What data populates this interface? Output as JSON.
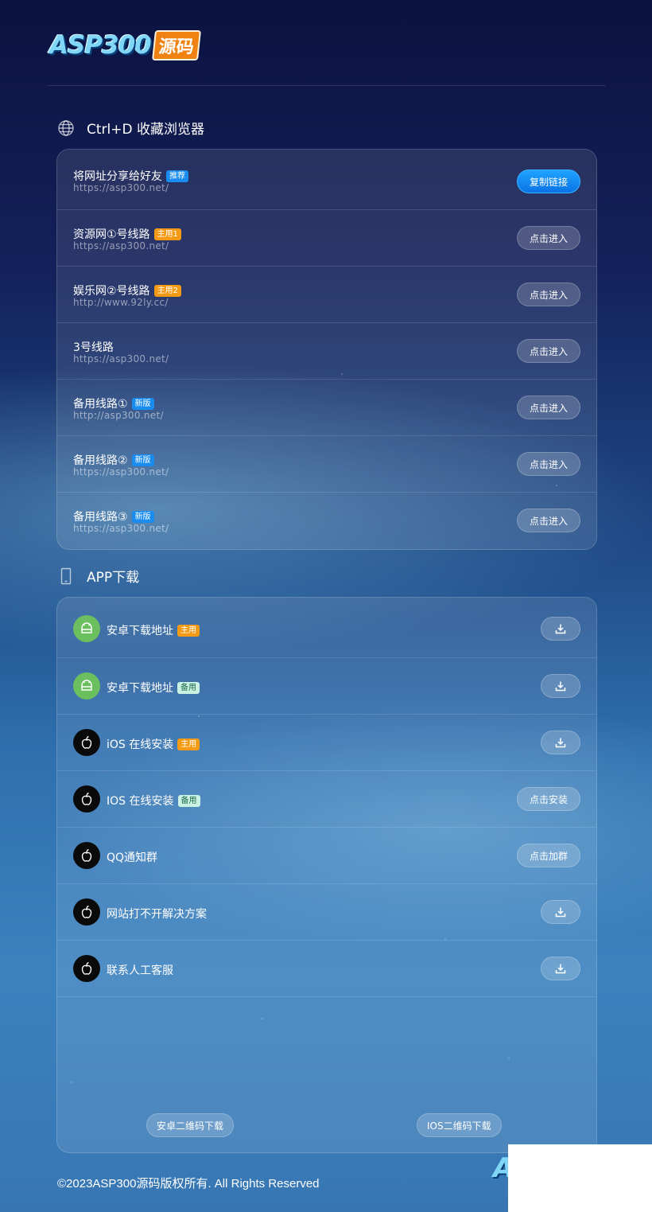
{
  "header": {
    "logo_text": "ASP300",
    "logo_badge": "源码"
  },
  "bookmark_section": {
    "title": "Ctrl+D 收藏浏览器",
    "icon": "globe-icon"
  },
  "links": [
    {
      "name": "将网址分享给好友",
      "tag": "推荐",
      "tag_color": "#1a8cf0",
      "url": "https://asp300.net/",
      "button": "复制链接",
      "primary": true
    },
    {
      "name": "资源网①号线路",
      "tag": "主用1",
      "tag_color": "#f49a14",
      "url": "https://asp300.net/",
      "button": "点击进入"
    },
    {
      "name": "娱乐网②号线路",
      "tag": "主用2",
      "tag_color": "#f49a14",
      "url": "http://www.92ly.cc/",
      "button": "点击进入"
    },
    {
      "name": "3号线路",
      "tag": "",
      "url": "https://asp300.net/",
      "button": "点击进入"
    },
    {
      "name": "备用线路①",
      "tag": "新版",
      "tag_color": "#1a8cf0",
      "url": "http://asp300.net/",
      "button": "点击进入"
    },
    {
      "name": "备用线路②",
      "tag": "新版",
      "tag_color": "#1a8cf0",
      "url": "https://asp300.net/",
      "button": "点击进入"
    },
    {
      "name": "备用线路③",
      "tag": "新版",
      "tag_color": "#1a8cf0",
      "url": "https://asp300.net/",
      "button": "点击进入"
    }
  ],
  "app_section": {
    "title": "APP下载",
    "icon": "phone-icon"
  },
  "apps": [
    {
      "name": "安卓下载地址",
      "tag": "主用",
      "icon": "android-icon",
      "button": ""
    },
    {
      "name": "安卓下载地址",
      "tag": "备用",
      "icon": "android-icon",
      "button": ""
    },
    {
      "name": "iOS 在线安装",
      "tag": "主用",
      "icon": "apple-icon",
      "button": ""
    },
    {
      "name": "IOS 在线安装",
      "tag": "备用",
      "icon": "apple-icon",
      "button": "点击安装"
    },
    {
      "name": "QQ通知群",
      "tag": "",
      "icon": "apple-icon",
      "button": "点击加群"
    },
    {
      "name": "网站打不开解决方案",
      "tag": "",
      "icon": "apple-icon",
      "button": ""
    },
    {
      "name": "联系人工客服",
      "tag": "",
      "icon": "apple-icon",
      "button": ""
    }
  ],
  "qr": {
    "android_label": "安卓二维码下载",
    "ios_label": "IOS二维码下载"
  },
  "footer": {
    "copyright": "©2023ASP300源码版权所有. All Rights Reserved"
  },
  "colors": {
    "primary_button": "#0a72e6",
    "tag_orange": "#f49a14",
    "tag_blue": "#1a8cf0",
    "tag_mint": "#c9f2e3",
    "android": "#6cbf5e"
  }
}
